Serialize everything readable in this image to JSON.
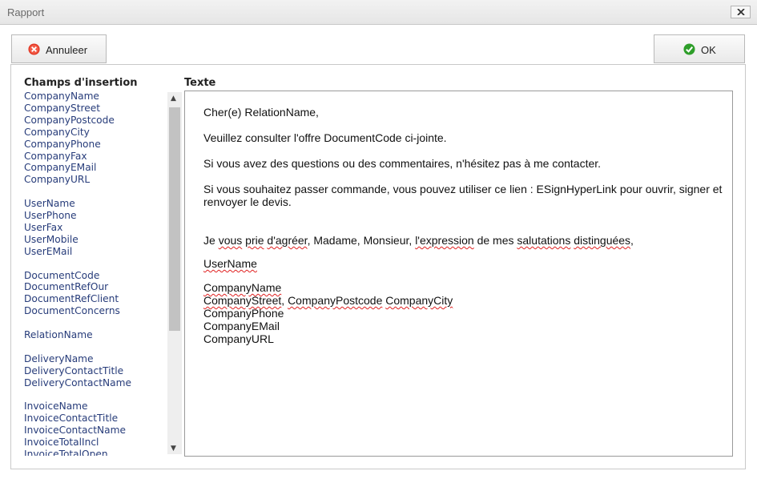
{
  "window": {
    "title": "Rapport"
  },
  "toolbar": {
    "cancel_label": "Annuleer",
    "ok_label": "OK"
  },
  "insertion": {
    "heading": "Champs d'insertion",
    "groups": [
      [
        "CompanyName",
        "CompanyStreet",
        "CompanyPostcode",
        "CompanyCity",
        "CompanyPhone",
        "CompanyFax",
        "CompanyEMail",
        "CompanyURL"
      ],
      [
        "UserName",
        "UserPhone",
        "UserFax",
        "UserMobile",
        "UserEMail"
      ],
      [
        "DocumentCode",
        "DocumentRefOur",
        "DocumentRefClient",
        "DocumentConcerns"
      ],
      [
        "RelationName"
      ],
      [
        "DeliveryName",
        "DeliveryContactTitle",
        "DeliveryContactName"
      ],
      [
        "InvoiceName",
        "InvoiceContactTitle",
        "InvoiceContactName",
        "InvoiceTotalIncl",
        "InvoiceTotalOpen"
      ]
    ]
  },
  "editor": {
    "heading": "Texte",
    "salutation": "Cher(e) RelationName,",
    "line_offer": "Veuillez consulter l'offre DocumentCode ci-jointe.",
    "line_questions": "Si vous avez des questions ou des commentaires, n'hésitez pas à me contacter.",
    "line_order_1": "Si vous souhaitez passer commande, vous pouvez utiliser ce lien : ESignHyperLink pour ouvrir, signer et",
    "line_order_2": "renvoyer le devis.",
    "closing_a": "Je ",
    "closing_b": "vous",
    "closing_c": " ",
    "closing_d": "prie",
    "closing_e": " ",
    "closing_f": "d'agréer",
    "closing_g": ", Madame, Monsieur, ",
    "closing_h": "l'expression",
    "closing_i": " de mes ",
    "closing_j": "salutations",
    "closing_k": " ",
    "closing_l": "distinguées",
    "closing_m": ",",
    "sig_user": "UserName",
    "sig_company": "CompanyName",
    "sig_street": "CompanyStreet",
    "sig_comma": ", ",
    "sig_postcode": "CompanyPostcode",
    "sig_space": " ",
    "sig_city": "CompanyCity",
    "sig_phone": "CompanyPhone",
    "sig_email": "CompanyEMail",
    "sig_url": "CompanyURL"
  },
  "colors": {
    "field_text": "#273c7a",
    "spellcheck": "#e02020",
    "cancel_icon": "#e0301e",
    "ok_icon": "#2e9e2a"
  }
}
